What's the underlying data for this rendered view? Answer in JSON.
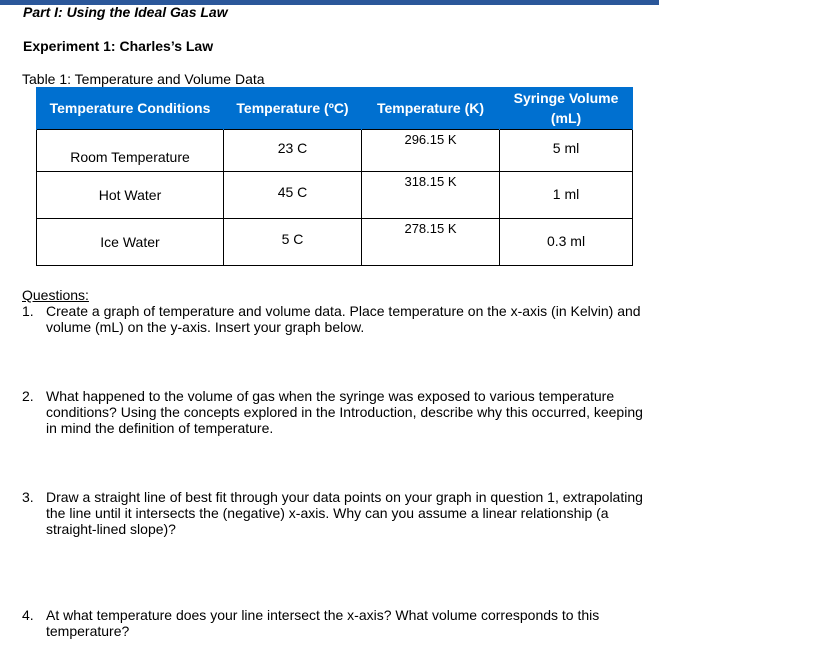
{
  "document": {
    "accent_color": "#2b579a",
    "part_title": "Part I: Using the Ideal Gas Law",
    "experiment_title": "Experiment 1: Charles’s Law",
    "table_caption": "Table 1: Temperature and Volume Data",
    "table": {
      "header_color": "#0070d0",
      "columns": [
        "Temperature Conditions",
        "Temperature (ºC)",
        "Temperature (K)",
        "Syringe Volume (mL)"
      ],
      "rows": [
        {
          "condition": "Room Temperature",
          "celsius": "23 C",
          "kelvin": "296.15 K",
          "volume": "5 ml"
        },
        {
          "condition": "Hot Water",
          "celsius": "45 C",
          "kelvin": "318.15 K",
          "volume": "1 ml"
        },
        {
          "condition": "Ice Water",
          "celsius": "5 C",
          "kelvin": "278.15 K",
          "volume": "0.3 ml"
        }
      ]
    },
    "questions_heading": "Questions:",
    "questions": [
      {
        "num": "1.",
        "text": "Create a graph of temperature and volume data. Place temperature on the x-axis (in Kelvin) and volume (mL) on the y-axis. Insert your graph below."
      },
      {
        "num": "2.",
        "text": "What happened to the volume of gas when the syringe was exposed to various temperature conditions? Using the concepts explored in the Introduction, describe why this occurred, keeping in mind the definition of temperature."
      },
      {
        "num": "3.",
        "text": "Draw a straight line of best fit through your data points on your graph in question 1, extrapolating the line until it intersects the (negative) x-axis. Why can you assume a linear relationship (a straight-lined slope)?"
      },
      {
        "num": "4.",
        "text": "At what temperature does your line intersect the x-axis? What volume corresponds to this temperature?"
      }
    ]
  }
}
